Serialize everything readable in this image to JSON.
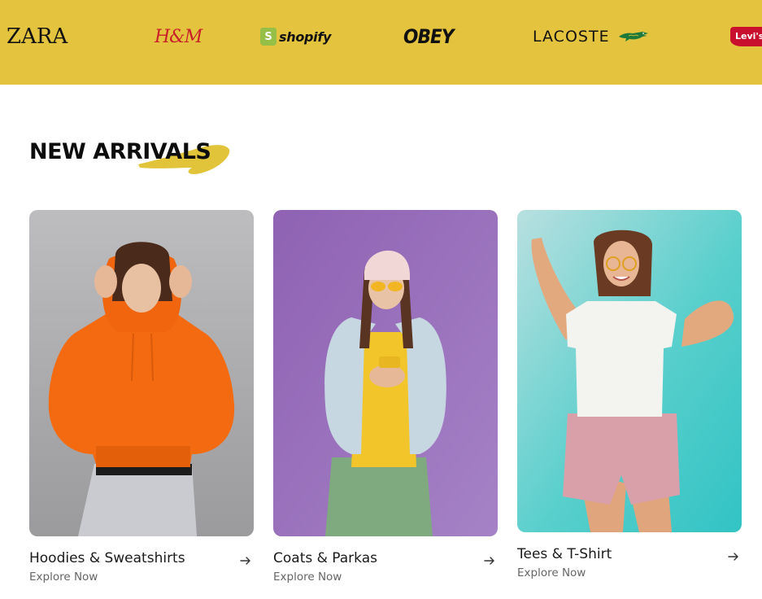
{
  "brands": {
    "zara": "ZARA",
    "hm": "H&M",
    "shopify_mark": "S",
    "shopify": "shopify",
    "obey": "OBEY",
    "lacoste": "LACOSTE",
    "levis": "Levi's"
  },
  "colors": {
    "brand_strip": "#e4c43f",
    "accent_swoosh": "#e2c43b"
  },
  "section": {
    "title": "NEW ARRIVALS"
  },
  "cards": [
    {
      "title": "Hoodies & Sweatshirts",
      "cta": "Explore Now",
      "icon": "arrow-right-icon"
    },
    {
      "title": "Coats & Parkas",
      "cta": "Explore Now",
      "icon": "arrow-right-icon"
    },
    {
      "title": "Tees & T-Shirt",
      "cta": "Explore Now",
      "icon": "arrow-right-icon"
    }
  ]
}
